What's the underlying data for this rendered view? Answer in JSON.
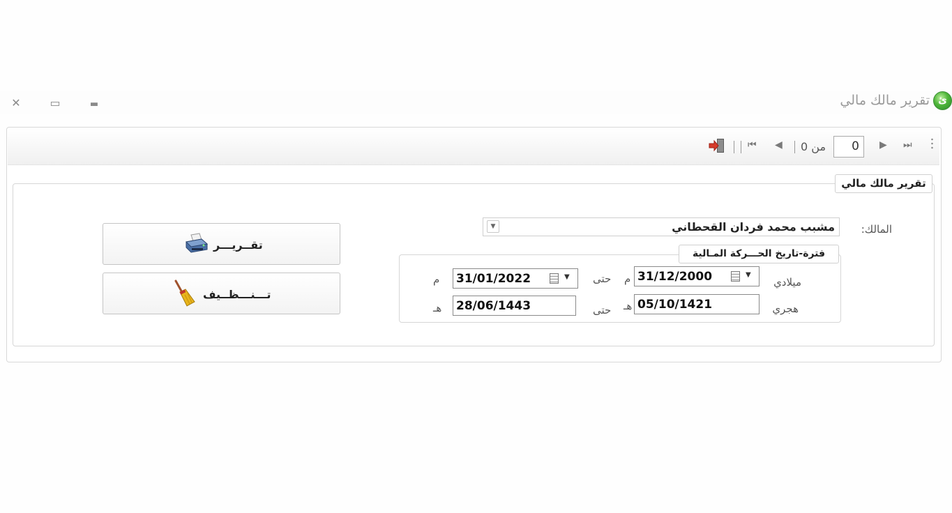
{
  "window": {
    "title": "تقرير مالك مالي",
    "logo_letter": "ئ",
    "close_icon": "✕",
    "restore_icon": "▭",
    "minimize_icon": "▬"
  },
  "toolbar": {
    "page_value": "0",
    "page_of_label": "من 0",
    "first_icon": "⏮",
    "prev_icon": "◀",
    "next_icon": "▶",
    "last_icon": "⏭"
  },
  "form": {
    "group_title": "تقرير مالك مالي",
    "owner_label": "المالك:",
    "owner_value": "مشبب محمد فردان القحطاني",
    "period_title": "فترة-تاريخ الحـــركة المـالية",
    "gregorian_label": "ميلادي",
    "hijri_label": "هجري",
    "to_label": "حتى",
    "gregorian_suffix": "م",
    "hijri_suffix": "هـ",
    "gregorian_from": "31/12/2000",
    "gregorian_to": "31/01/2022",
    "hijri_from": "05/10/1421",
    "hijri_to": "28/06/1443"
  },
  "buttons": {
    "report_label": "تقــريـــر",
    "clear_label": "تـــنـــظــيف"
  },
  "colors": {
    "logo_green": "#4fb63a",
    "exit_red": "#d63a2a",
    "broom_yellow": "#e8b51c"
  }
}
